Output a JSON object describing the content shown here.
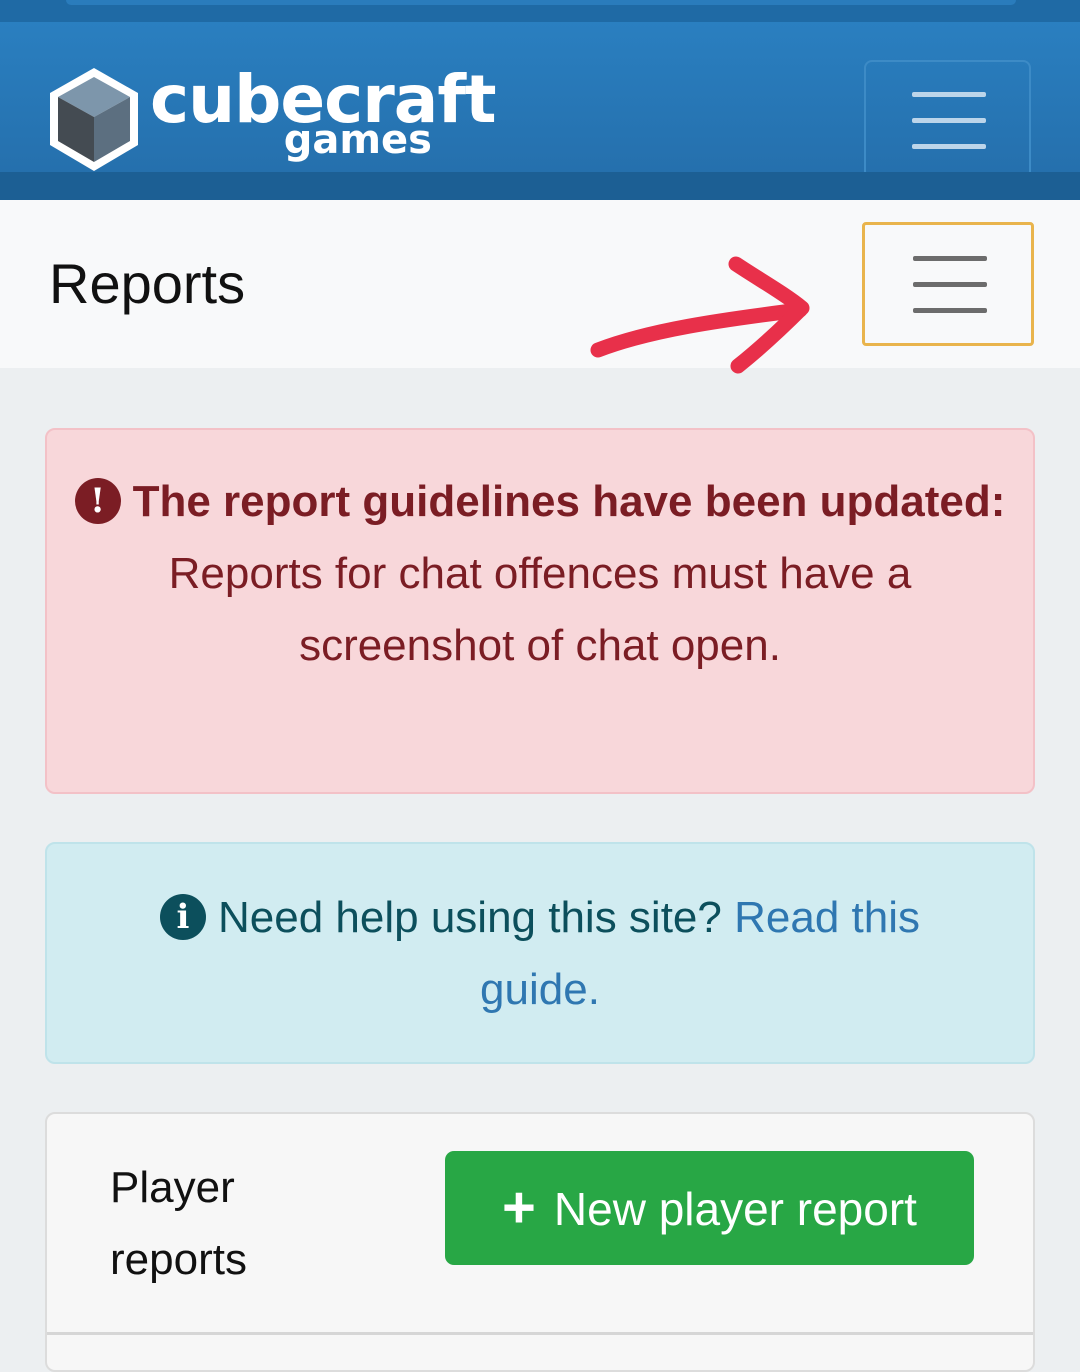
{
  "brand": {
    "name": "cubecraft",
    "sub": "games"
  },
  "page": {
    "title": "Reports"
  },
  "alerts": {
    "guidelines": {
      "title": "The report guidelines have been updated:",
      "body": "Reports for chat offences must have a screenshot of chat open."
    },
    "help": {
      "text": "Need help using this site? ",
      "link": "Read this guide."
    }
  },
  "player_reports": {
    "title": "Player reports",
    "button": "New player report"
  },
  "colors": {
    "navbar": "#2570ad",
    "danger": "#f8d7da",
    "info": "#d1ecf1",
    "success": "#28a745",
    "highlight": "#e9b44c",
    "annotation_arrow": "#e8304a"
  },
  "icons": [
    "cube-logo-icon",
    "menu-icon",
    "exclamation-circle-icon",
    "info-circle-icon",
    "plus-icon",
    "annotation-arrow-icon"
  ]
}
